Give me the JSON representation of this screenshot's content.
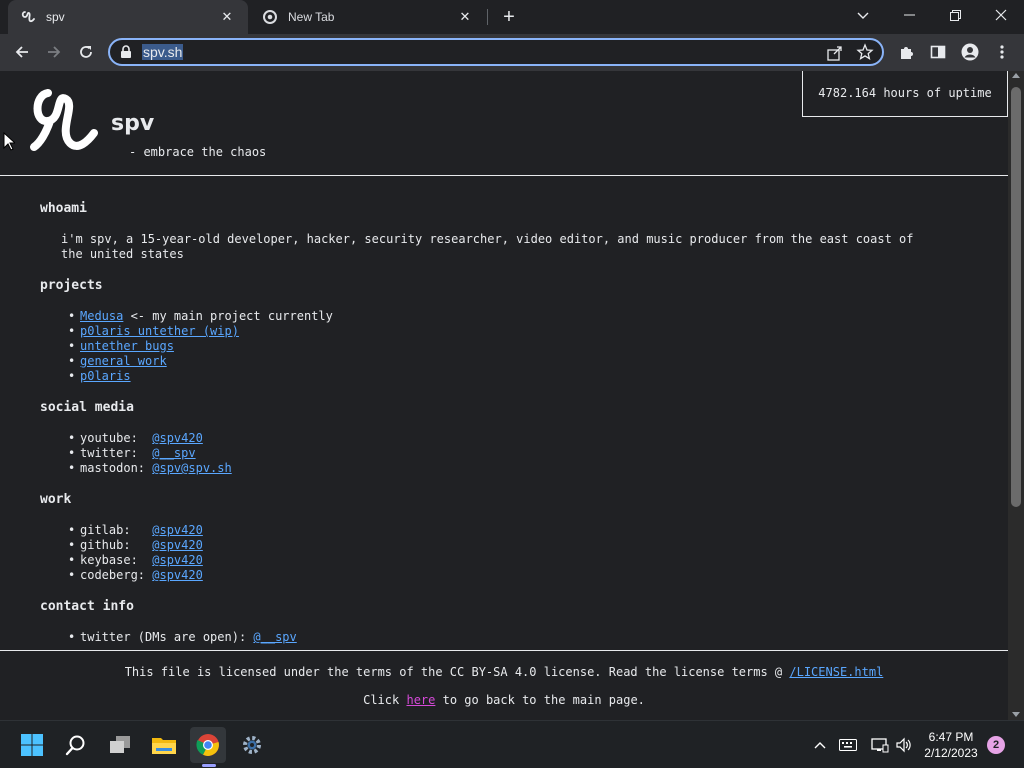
{
  "browser": {
    "tabs": [
      {
        "title": "spv",
        "favicon": "spv-logo-icon",
        "active": true
      },
      {
        "title": "New Tab",
        "favicon": "chrome-icon",
        "active": false
      }
    ],
    "address": "spv.sh"
  },
  "header": {
    "site_name": "spv",
    "tagline": "- embrace the chaos",
    "uptime": "4782.164 hours of uptime"
  },
  "sections": {
    "whoami": {
      "title": "whoami",
      "text": "i'm spv, a 15-year-old developer, hacker, security researcher, video editor, and music producer from the east coast of the united states"
    },
    "projects": {
      "title": "projects",
      "items": [
        {
          "link": "Medusa",
          "suffix": " <- my main project currently"
        },
        {
          "link": "p0laris untether (wip)"
        },
        {
          "link": "untether bugs"
        },
        {
          "link": "general work"
        },
        {
          "link": "p0laris"
        }
      ]
    },
    "social": {
      "title": "social media",
      "items": [
        {
          "label": "youtube:  ",
          "link": "@spv420"
        },
        {
          "label": "twitter:  ",
          "link": "@__spv"
        },
        {
          "label": "mastodon: ",
          "link": "@spv@spv.sh"
        }
      ]
    },
    "work": {
      "title": "work",
      "items": [
        {
          "label": "gitlab:   ",
          "link": "@spv420"
        },
        {
          "label": "github:   ",
          "link": "@spv420"
        },
        {
          "label": "keybase:  ",
          "link": "@spv420"
        },
        {
          "label": "codeberg: ",
          "link": "@spv420"
        }
      ]
    },
    "contact": {
      "title": "contact info",
      "items": [
        {
          "label": "twitter (DMs are open): ",
          "link": "@__spv"
        }
      ]
    }
  },
  "footer": {
    "license_prefix": "This file is licensed under the terms of the CC BY-SA 4.0 license. Read the license terms @ ",
    "license_link": "/LICENSE.html",
    "back_prefix": "Click ",
    "back_link": "here",
    "back_suffix": " to go back to the main page."
  },
  "taskbar": {
    "time": "6:47 PM",
    "date": "2/12/2023",
    "notifications": "2"
  },
  "colors": {
    "link": "#5aa7ff",
    "visited_link": "#d54ad8",
    "background": "#202124",
    "accent": "#8ab4f8"
  }
}
